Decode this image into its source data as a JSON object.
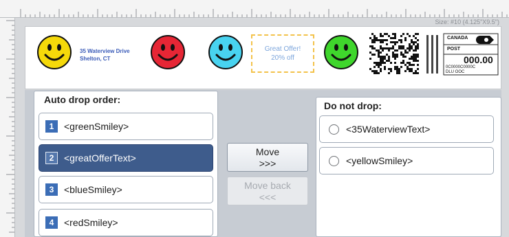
{
  "ruler": {
    "size_label": "Size: #10 (4.125\"X9.5\")"
  },
  "envelope": {
    "address_line1": "35 Waterview Drive",
    "address_line2": "Shelton, CT",
    "offer_line1": "Great Offer!",
    "offer_line2": "20% off",
    "postage": {
      "country": "CANADA",
      "post": "POST",
      "amount": "000.00",
      "code_line1": "0C0000C0000C",
      "code_line2": "DLU OOC"
    },
    "smiley_colors": {
      "yellow": "#f5d90a",
      "red": "#e62635",
      "blue": "#48d3f0",
      "green": "#3fd62c"
    }
  },
  "auto_drop": {
    "title": "Auto drop order:",
    "items": [
      {
        "number": "1",
        "label": "<greenSmiley>"
      },
      {
        "number": "2",
        "label": "<greatOfferText>"
      },
      {
        "number": "3",
        "label": "<blueSmiley>"
      },
      {
        "number": "4",
        "label": "<redSmiley>"
      }
    ]
  },
  "buttons": {
    "move_line1": "Move",
    "move_line2": ">>>",
    "back_line1": "Move back",
    "back_line2": "<<<"
  },
  "do_not_drop": {
    "title": "Do not drop:",
    "items": [
      {
        "label": "<35WaterviewText>"
      },
      {
        "label": "<yellowSmiley>"
      }
    ]
  },
  "colors": {
    "selected": "#3e5c8c",
    "number_badge": "#3b6db6"
  }
}
